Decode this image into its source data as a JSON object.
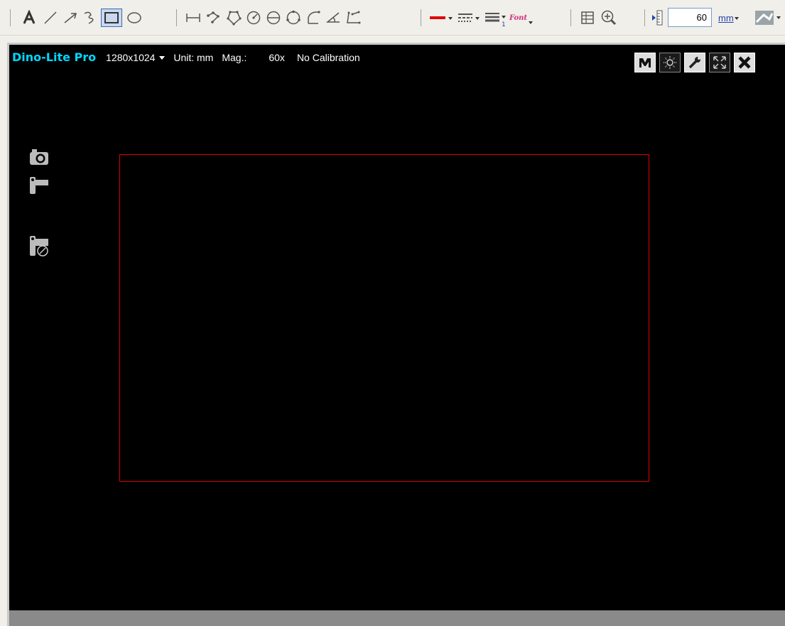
{
  "toolbar": {
    "tools": [
      {
        "id": "text",
        "icon": "text-tool-icon"
      },
      {
        "id": "line",
        "icon": "line-tool-icon"
      },
      {
        "id": "arrow",
        "icon": "arrow-tool-icon"
      },
      {
        "id": "freehand",
        "icon": "freehand-tool-icon"
      },
      {
        "id": "rectangle",
        "icon": "rectangle-tool-icon",
        "selected": true
      },
      {
        "id": "ellipse",
        "icon": "ellipse-tool-icon"
      },
      {
        "id": "distance",
        "icon": "distance-tool-icon"
      },
      {
        "id": "polyline",
        "icon": "polyline-tool-icon"
      },
      {
        "id": "polygon",
        "icon": "polygon-tool-icon"
      },
      {
        "id": "circle-radius",
        "icon": "circle-radius-tool-icon"
      },
      {
        "id": "circle-diameter",
        "icon": "circle-diameter-tool-icon"
      },
      {
        "id": "circle-3pt",
        "icon": "circle-three-point-tool-icon"
      },
      {
        "id": "freeform",
        "icon": "freeform-tool-icon"
      },
      {
        "id": "angle",
        "icon": "angle-tool-icon"
      },
      {
        "id": "angle-4pt",
        "icon": "four-point-angle-tool-icon"
      }
    ],
    "line_color": "#e00000",
    "font_label": "Font",
    "zoom_value": "60",
    "unit_label": "mm"
  },
  "viewer": {
    "brand": "Dino-Lite Pro",
    "resolution": "1280x1024",
    "unit": "Unit: mm",
    "mag_label": "Mag.:",
    "mag_value": "60x",
    "calibration": "No Calibration",
    "roi_color": "#e00000"
  }
}
